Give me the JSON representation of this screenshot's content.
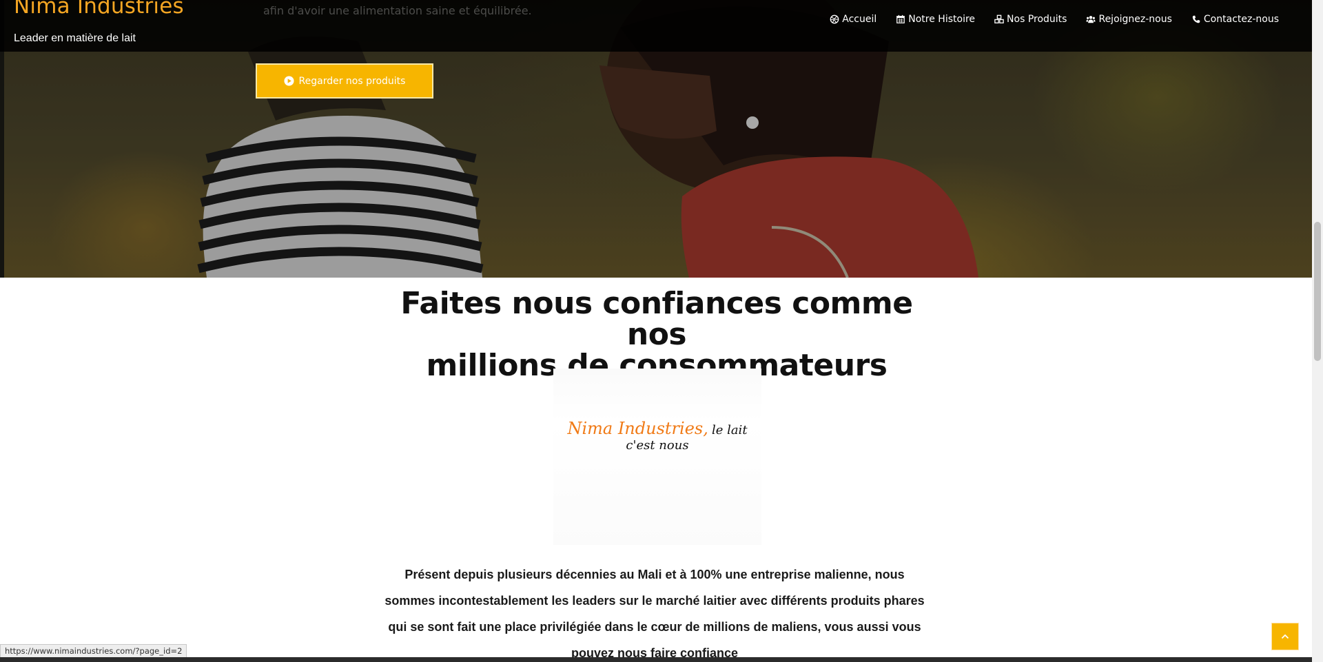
{
  "brand": {
    "name": "Nima Industries",
    "tagline": "Leader en matière de lait"
  },
  "hero": {
    "blurb": "afin d'avoir une alimentation saine et équilibrée.",
    "cta_label": "Regarder nos produits",
    "cta_icon": "circle-play-icon"
  },
  "nav": {
    "items": [
      {
        "label": "Accueil",
        "icon": "dribbble-icon"
      },
      {
        "label": "Notre Histoire",
        "icon": "calendar-icon"
      },
      {
        "label": "Nos Produits",
        "icon": "cubes-icon"
      },
      {
        "label": "Rejoignez-nous",
        "icon": "users-icon"
      },
      {
        "label": "Contactez-nous",
        "icon": "phone-icon"
      }
    ]
  },
  "main": {
    "heading_line1": "Faites nous confiances comme nos",
    "heading_line2": "millions de consommateurs",
    "banner_brand": "Nima Industries,",
    "banner_slogan": "le lait c'est nous",
    "paragraph": "Présent depuis plusieurs décennies au Mali et à 100% une entreprise malienne, nous sommes incontestablement les leaders sur le marché laitier avec différents produits phares qui se sont fait une place privilégiée dans le cœur de millions de maliens, vous aussi vous pouvez nous faire confiance"
  },
  "status_bar": {
    "url": "https://www.nimaindustries.com/?page_id=2"
  },
  "colors": {
    "accent": "#f7b500",
    "brand": "#f5a623",
    "banner_brand": "#f07a16",
    "topbar": "#000000"
  }
}
